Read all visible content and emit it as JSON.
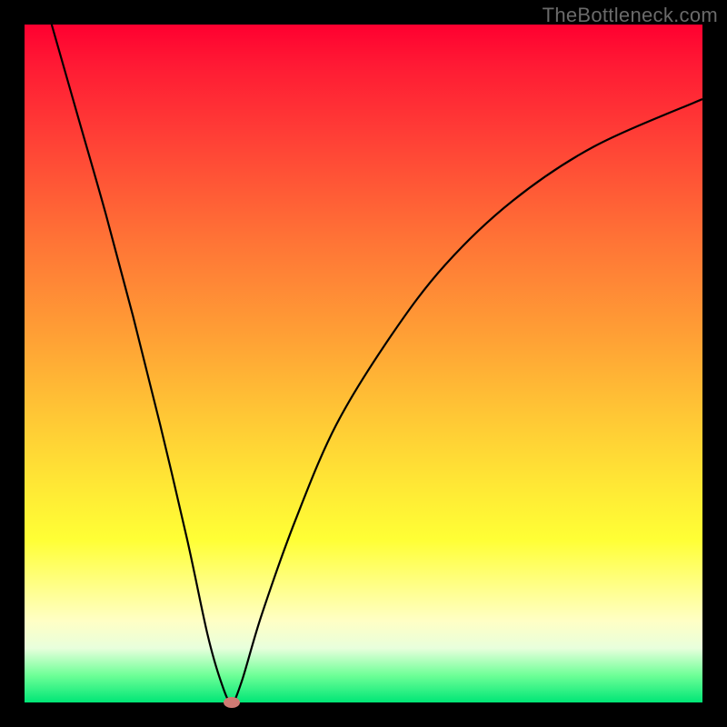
{
  "watermark": "TheBottleneck.com",
  "chart_data": {
    "type": "line",
    "title": "",
    "xlabel": "",
    "ylabel": "",
    "xlim": [
      0,
      100
    ],
    "ylim": [
      0,
      100
    ],
    "curve": {
      "name": "bottleneck-curve",
      "x": [
        4,
        8,
        12,
        16,
        20,
        24,
        27,
        29,
        30.5,
        32,
        35,
        40,
        46,
        54,
        62,
        72,
        84,
        100
      ],
      "y": [
        100,
        86,
        72,
        57,
        41,
        24,
        10,
        3,
        0,
        3,
        13,
        27,
        41,
        54,
        64.5,
        74,
        82,
        89
      ]
    },
    "marker": {
      "x": 30.5,
      "y": 0,
      "color": "#cf7a73"
    },
    "gradient_stops": [
      {
        "pos": 0.0,
        "color": "#ff0030"
      },
      {
        "pos": 0.46,
        "color": "#ffa035"
      },
      {
        "pos": 0.76,
        "color": "#ffff35"
      },
      {
        "pos": 1.0,
        "color": "#00e676"
      }
    ]
  },
  "layout": {
    "image_size": 800,
    "frame_inset": 27,
    "plot_size": 746
  }
}
